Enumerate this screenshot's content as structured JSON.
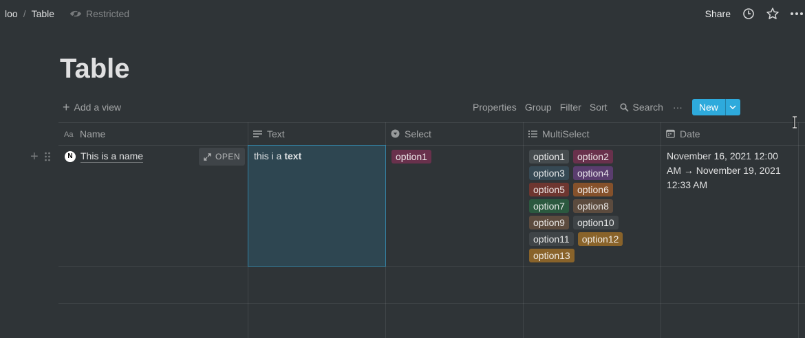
{
  "breadcrumb": {
    "workspace": "loo",
    "separator": "/",
    "page": "Table",
    "restricted_label": "Restricted"
  },
  "topbar": {
    "share_label": "Share",
    "icons": [
      "eye-off-icon",
      "clock-icon",
      "star-icon",
      "more-icon"
    ]
  },
  "page_title": "Table",
  "viewbar": {
    "add_view_label": "Add a view",
    "properties_label": "Properties",
    "group_label": "Group",
    "filter_label": "Filter",
    "sort_label": "Sort",
    "search_label": "Search",
    "more_label": "···",
    "new_label": "New"
  },
  "columns": [
    {
      "label": "Name",
      "icon": "text-aa-icon"
    },
    {
      "label": "Text",
      "icon": "text-lines-icon"
    },
    {
      "label": "Select",
      "icon": "select-icon"
    },
    {
      "label": "MultiSelect",
      "icon": "list-icon"
    },
    {
      "label": "Date",
      "icon": "calendar-icon"
    }
  ],
  "row": {
    "name": "This is a name",
    "open_label": "OPEN",
    "text_plain": "this i a ",
    "text_bold": "text",
    "select": {
      "label": "option1",
      "color": "#69314c"
    },
    "multiselect": [
      [
        {
          "label": "option1",
          "color": "#454b4e"
        },
        {
          "label": "option2",
          "color": "#69314c"
        }
      ],
      [
        {
          "label": "option3",
          "color": "#364954"
        },
        {
          "label": "option4",
          "color": "#5a3d6e"
        }
      ],
      [
        {
          "label": "option5",
          "color": "#6e3630"
        },
        {
          "label": "option6",
          "color": "#85512b"
        }
      ],
      [
        {
          "label": "option7",
          "color": "#2b593f"
        },
        {
          "label": "option8",
          "color": "#5c4b3e"
        }
      ],
      [
        {
          "label": "option9",
          "color": "#5c4b3e"
        },
        {
          "label": "option10",
          "color": "#3f4447"
        }
      ],
      [
        {
          "label": "option11",
          "color": "#3f4447"
        },
        {
          "label": "option12",
          "color": "#89632a"
        }
      ],
      [
        {
          "label": "option13",
          "color": "#89632a"
        }
      ]
    ],
    "date": "November 16, 2021 12:00 AM → November 19, 2021 12:33 AM"
  }
}
